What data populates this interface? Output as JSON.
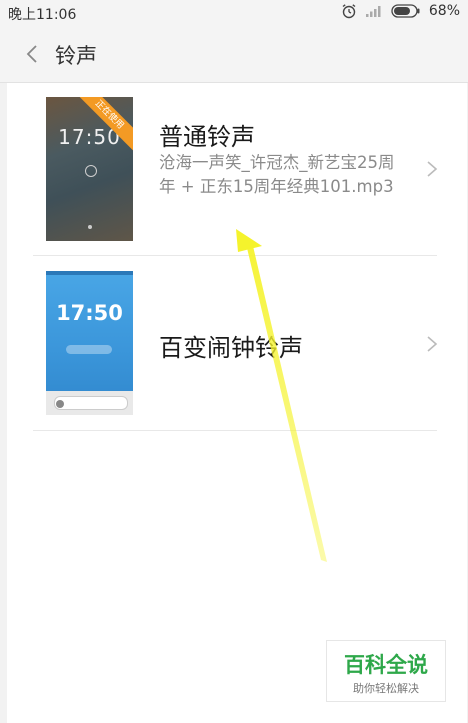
{
  "status_bar": {
    "time": "晚上11:06",
    "battery": "68%"
  },
  "header": {
    "title": "铃声"
  },
  "items": [
    {
      "title": "普通铃声",
      "description": "沧海一声笑_许冠杰_新艺宝25周年 + 正东15周年经典101.mp3",
      "thumb_time": "17:50",
      "badge": "正在使用"
    },
    {
      "title": "百变闹钟铃声",
      "thumb_time": "17:50"
    }
  ],
  "watermark": {
    "main": "百科全说",
    "sub": "助你轻松解决"
  },
  "colors": {
    "annotation_arrow": "#f5f32c",
    "watermark_green": "#2ea84a",
    "badge_orange": "#f39a24"
  }
}
